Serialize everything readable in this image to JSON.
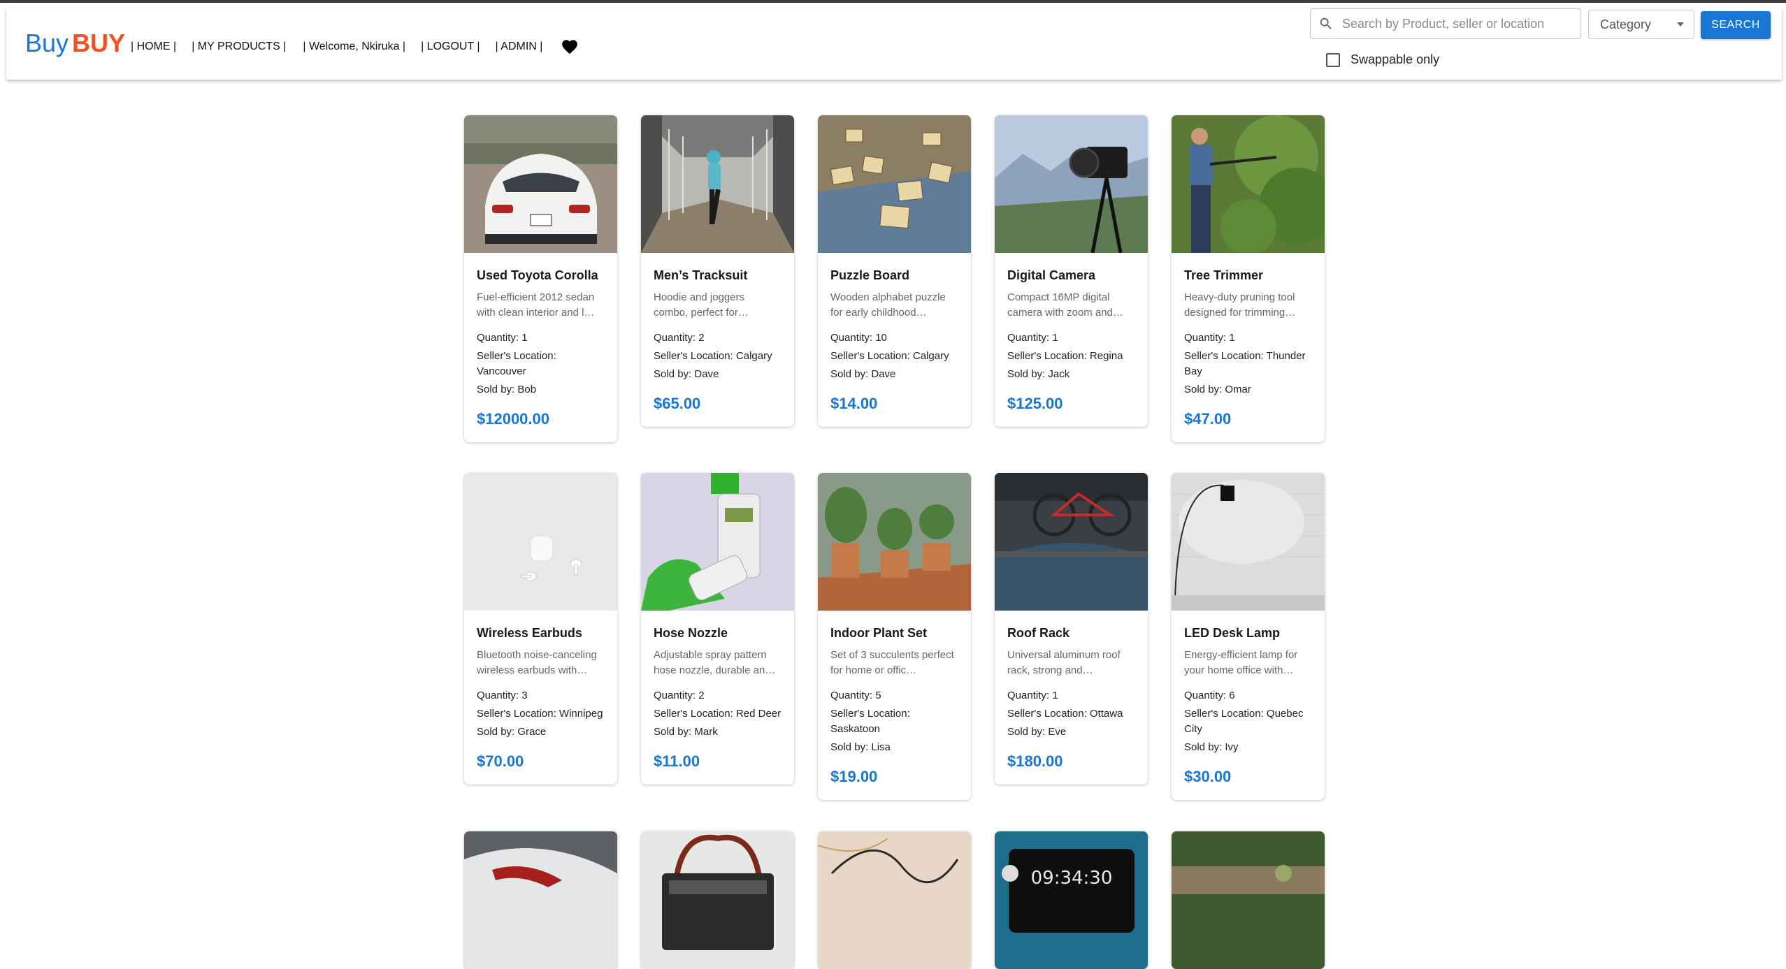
{
  "brand": {
    "part1": "Buy",
    "part2": "BUY"
  },
  "nav": {
    "home": "| HOME |",
    "my_products": "| MY PRODUCTS |",
    "welcome": "| Welcome, Nkiruka |",
    "logout": "| LOGOUT |",
    "admin": "| ADMIN |"
  },
  "search": {
    "placeholder": "Search by Product, seller or location",
    "category_label": "Category",
    "button": "SEARCH",
    "swappable_label": "Swappable only"
  },
  "products": [
    {
      "title": "Used Toyota Corolla",
      "desc": "Fuel-efficient 2012 sedan with clean interior and l…",
      "quantity": "Quantity: 1",
      "location": "Seller's Location: Vancouver",
      "seller": "Sold by: Bob",
      "price": "$12000.00",
      "icon": "car-photo"
    },
    {
      "title": "Men’s Tracksuit",
      "desc": "Hoodie and joggers combo, perfect for…",
      "quantity": "Quantity: 2",
      "location": "Seller's Location: Calgary",
      "seller": "Sold by: Dave",
      "price": "$65.00",
      "icon": "tracksuit-photo"
    },
    {
      "title": "Puzzle Board",
      "desc": "Wooden alphabet puzzle for early childhood…",
      "quantity": "Quantity: 10",
      "location": "Seller's Location: Calgary",
      "seller": "Sold by: Dave",
      "price": "$14.00",
      "icon": "puzzle-photo"
    },
    {
      "title": "Digital Camera",
      "desc": "Compact 16MP digital camera with zoom and…",
      "quantity": "Quantity: 1",
      "location": "Seller's Location: Regina",
      "seller": "Sold by: Jack",
      "price": "$125.00",
      "icon": "camera-photo"
    },
    {
      "title": "Tree Trimmer",
      "desc": "Heavy-duty pruning tool designed for trimming…",
      "quantity": "Quantity: 1",
      "location": "Seller's Location: Thunder Bay",
      "seller": "Sold by: Omar",
      "price": "$47.00",
      "icon": "trimmer-photo"
    },
    {
      "title": "Wireless Earbuds",
      "desc": "Bluetooth noise-canceling wireless earbuds with…",
      "quantity": "Quantity: 3",
      "location": "Seller's Location: Winnipeg",
      "seller": "Sold by: Grace",
      "price": "$70.00",
      "icon": "earbuds-photo"
    },
    {
      "title": "Hose Nozzle",
      "desc": "Adjustable spray pattern hose nozzle, durable an…",
      "quantity": "Quantity: 2",
      "location": "Seller's Location: Red Deer",
      "seller": "Sold by: Mark",
      "price": "$11.00",
      "icon": "nozzle-photo"
    },
    {
      "title": "Indoor Plant Set",
      "desc": "Set of 3 succulents perfect for home or offic…",
      "quantity": "Quantity: 5",
      "location": "Seller's Location: Saskatoon",
      "seller": "Sold by: Lisa",
      "price": "$19.00",
      "icon": "plants-photo"
    },
    {
      "title": "Roof Rack",
      "desc": "Universal aluminum roof rack, strong and…",
      "quantity": "Quantity: 1",
      "location": "Seller's Location: Ottawa",
      "seller": "Sold by: Eve",
      "price": "$180.00",
      "icon": "roofrack-photo"
    },
    {
      "title": "LED Desk Lamp",
      "desc": "Energy-efficient lamp for your home office with…",
      "quantity": "Quantity: 6",
      "location": "Seller's Location: Quebec City",
      "seller": "Sold by: Ivy",
      "price": "$30.00",
      "icon": "lamp-photo"
    }
  ],
  "partial_row": [
    {
      "icon": "car-taillight-photo"
    },
    {
      "icon": "radio-photo"
    },
    {
      "icon": "cables-photo"
    },
    {
      "icon": "clock-photo",
      "clock_text": "09:34:30"
    },
    {
      "icon": "garden-photo"
    }
  ]
}
